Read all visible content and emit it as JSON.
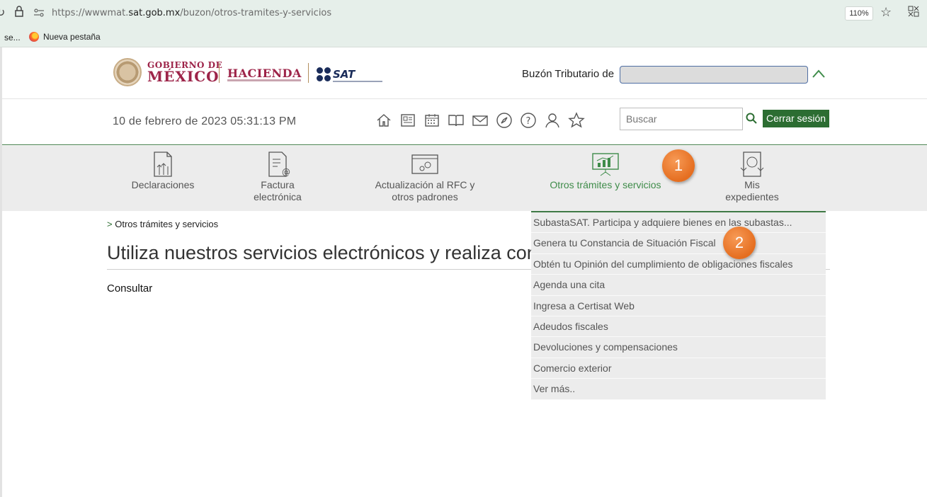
{
  "browser": {
    "url_prefix": "https://wwwmat.",
    "url_domain": "sat.gob.mx",
    "url_path": "/buzon/otros-tramites-y-servicios",
    "zoom": "110%",
    "bookmarks": [
      "se...",
      "Nueva pestaña"
    ]
  },
  "header": {
    "gob_line1": "GOBIERNO DE",
    "gob_line2": "MÉXICO",
    "hacienda": "HACIENDA",
    "sat": "SAT",
    "buzon_label": "Buzón Tributario de"
  },
  "toolbar": {
    "datetime": "10 de febrero de 2023 05:31:13 PM",
    "icons": [
      "home-icon",
      "news-icon",
      "calendar-icon",
      "book-icon",
      "mail-icon",
      "compass-icon",
      "help-icon",
      "user-icon",
      "star-icon"
    ],
    "search_placeholder": "Buscar",
    "logout_label": "Cerrar sesión"
  },
  "nav": {
    "items": [
      {
        "line1": "Declaraciones",
        "line2": ""
      },
      {
        "line1": "Factura",
        "line2": "electrónica"
      },
      {
        "line1": "Actualización al RFC y",
        "line2": "otros padrones"
      },
      {
        "line1": "Otros trámites y servicios",
        "line2": ""
      },
      {
        "line1": "Mis",
        "line2": "expedientes"
      }
    ],
    "active_index": 3
  },
  "annotations": {
    "badge1": "1",
    "badge2": "2"
  },
  "main": {
    "breadcrumb_sep": ">",
    "breadcrumb": "Otros trámites y servicios",
    "title": "Utiliza nuestros servicios electrónicos y realiza consu",
    "subhead": "Consultar"
  },
  "dropdown": {
    "items": [
      "SubastaSAT. Participa y adquiere bienes en las subastas...",
      "Genera tu Constancia de Situación Fiscal",
      "Obtén tu Opinión del cumplimiento de obligaciones fiscales",
      "Agenda una cita",
      "Ingresa a Certisat Web",
      "Adeudos fiscales",
      "Devoluciones y compensaciones",
      "Comercio exterior",
      "Ver más.."
    ]
  },
  "colors": {
    "brand_green": "#2c6d32",
    "active_green": "#3f8c4a",
    "gob_red": "#9d2449",
    "badge_orange": "#e56e20"
  }
}
